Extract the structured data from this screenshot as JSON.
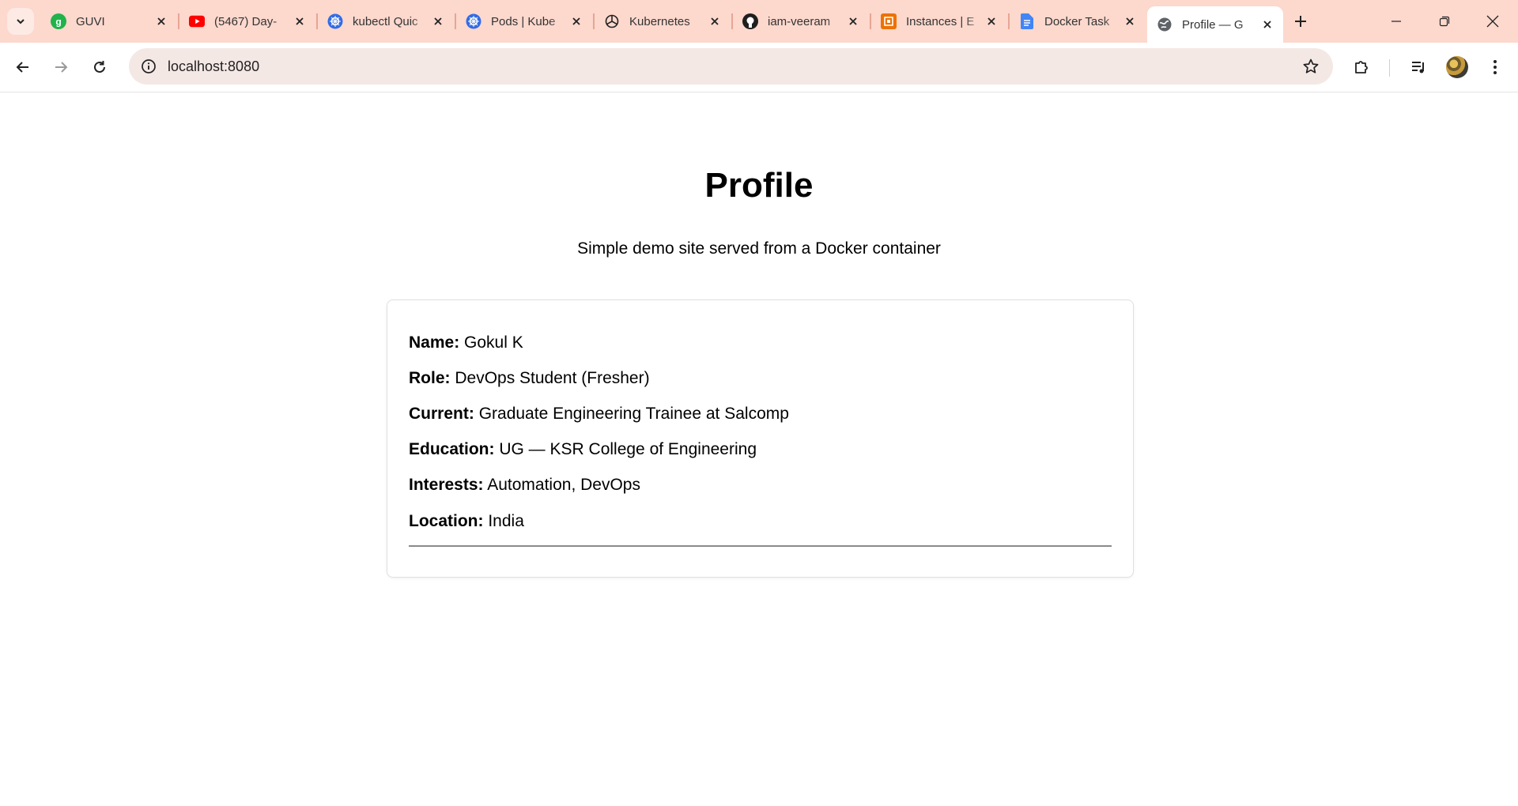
{
  "browser": {
    "tabs": [
      {
        "title": "GUVI",
        "icon": "guvi-icon"
      },
      {
        "title": "(5467) Day-",
        "icon": "youtube-icon"
      },
      {
        "title": "kubectl Quic",
        "icon": "kubernetes-icon"
      },
      {
        "title": "Pods | Kube",
        "icon": "kubernetes-icon"
      },
      {
        "title": "Kubernetes",
        "icon": "openai-icon"
      },
      {
        "title": "iam-veeram",
        "icon": "github-icon"
      },
      {
        "title": "Instances | E",
        "icon": "aws-ec2-icon"
      },
      {
        "title": "Docker Task",
        "icon": "google-docs-icon"
      },
      {
        "title": "Profile — G",
        "icon": "globe-icon",
        "active": true
      }
    ],
    "url": "localhost:8080",
    "colors": {
      "tabstrip": "#fcd8cd",
      "omnibox": "#f4e8e5"
    }
  },
  "page": {
    "title": "Profile",
    "subtitle": "Simple demo site served from a Docker container",
    "fields": [
      {
        "label": "Name:",
        "value": "Gokul K"
      },
      {
        "label": "Role:",
        "value": "DevOps Student (Fresher)"
      },
      {
        "label": "Current:",
        "value": "Graduate Engineering Trainee at Salcomp"
      },
      {
        "label": "Education:",
        "value": "UG — KSR College of Engineering"
      },
      {
        "label": "Interests:",
        "value": "Automation, DevOps"
      },
      {
        "label": "Location:",
        "value": "India"
      }
    ]
  }
}
